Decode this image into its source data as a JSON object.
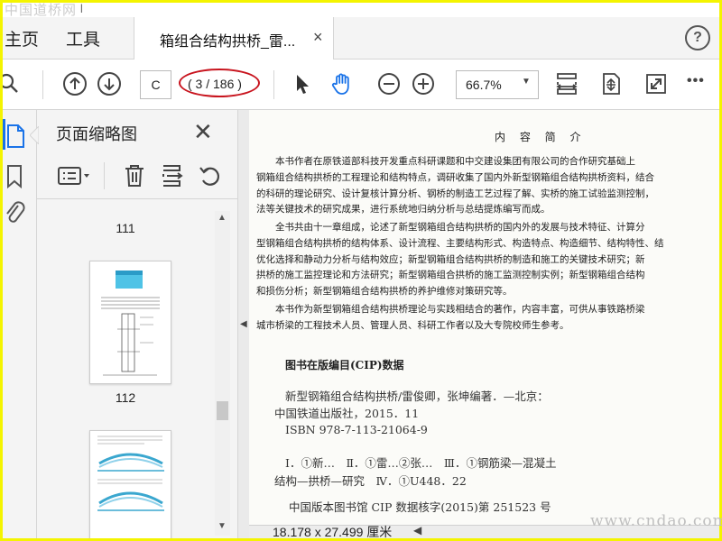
{
  "watermark": {
    "top": "中国道桥网",
    "bottom": "www.cndao.com"
  },
  "top_strip_text": "|",
  "menu": {
    "home": "主页",
    "tools": "工具"
  },
  "tab": {
    "title": "箱组合结构拱桥_雷...",
    "close": "×"
  },
  "help": "?",
  "toolbar": {
    "page_input": "C",
    "page_count": "( 3 / 186 )",
    "zoom": "66.7%",
    "more": "•••"
  },
  "sidebar": {
    "title": "页面缩略图",
    "close": "✕",
    "page_labels": [
      "111",
      "112"
    ]
  },
  "document": {
    "heading": "内 容 简 介",
    "paragraph1": [
      "　　本书作者在原铁道部科技开发重点科研课题和中交建设集团有限公司的合作研究基础上",
      "钢箱组合结构拱桥的工程理论和结构特点，调研收集了国内外新型钢箱组合结构拱桥资料，结合",
      "的科研的理论研究、设计复核计算分析、钢桥的制造工艺过程了解、实桥的施工试验监测控制，",
      "法等关键技术的研究成果，进行系统地归纳分析与总结提炼编写而成。"
    ],
    "paragraph2": [
      "　　全书共由十一章组成，论述了新型钢箱组合结构拱桥的国内外的发展与技术特征、计算分",
      "型钢箱组合结构拱桥的结构体系、设计流程、主要结构形式、构造特点、构造细节、结构特性、结",
      "优化选择和静动力分析与结构效应；新型钢箱组合结构拱桥的制造和施工的关键技术研究；新",
      "拱桥的施工监控理论和方法研究；新型钢箱组合拱桥的施工监测控制实例；新型钢箱组合结构",
      "和损伤分析；新型钢箱组合结构拱桥的养护维修对策研究等。"
    ],
    "paragraph3": [
      "　　本书作为新型钢箱组合结构拱桥理论与实践相结合的著作，内容丰富，可供从事铁路桥梁",
      "城市桥梁的工程技术人员、管理人员、科研工作者以及大专院校师生参考。"
    ],
    "cip_title": "图书在版编目(CIP)数据",
    "cip_lines": [
      "新型钢箱组合结构拱桥/雷俊卿，张坤编著．—北京：",
      "中国铁道出版社，2015．11",
      "ISBN 978-7-113-21064-9",
      "Ⅰ．①新…　Ⅱ．①雷…②张…　Ⅲ．①钢筋梁—混凝土",
      "结构—拱桥—研究　Ⅳ．①U448．22",
      "中国版本图书馆 CIP 数据核字(2015)第 251523 号"
    ]
  },
  "status": {
    "dimensions": "18.178 x 27.499 厘米"
  },
  "colors": {
    "frame": "#f4f400",
    "highlight": "#c8141e",
    "accent": "#1a73e8"
  }
}
